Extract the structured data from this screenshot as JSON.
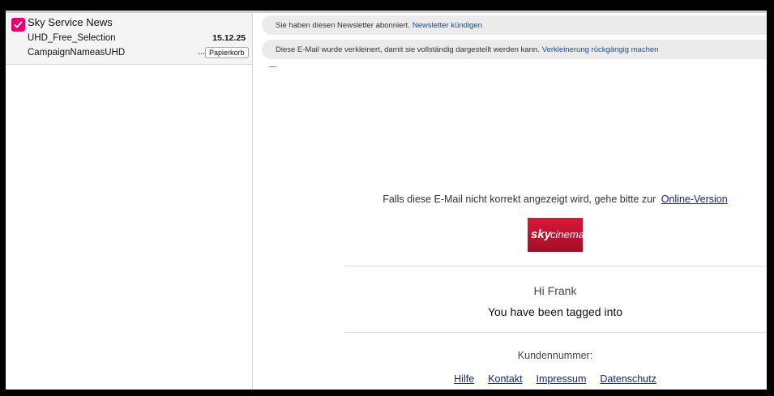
{
  "colors": {
    "accent": "#e20074",
    "link": "#1a4b9c",
    "sky_red": "#c8102e"
  },
  "mail_list": {
    "items": [
      {
        "checked": true,
        "sender": "Sky Service News",
        "subject": "UHD_Free_Selection",
        "date": "15.12.25",
        "preview": "CampaignNameasUHD",
        "ellipsis": "...",
        "folder_badge": "Papierkorb"
      }
    ]
  },
  "reading_pane": {
    "newsletter_bar": {
      "text": "Sie haben diesen Newsletter abonniert.",
      "link": "Newsletter kündigen"
    },
    "shrink_bar": {
      "text": "Diese E-Mail wurde verkleinert, damit sie vollständig dargestellt werden kann.",
      "link": "Verkleinerung rückgängig machen"
    },
    "email": {
      "online_text": "Falls diese E-Mail nicht korrekt angezeigt wird, gehe bitte zur",
      "online_link": "Online-Version",
      "logo_text": "sky cinema",
      "greeting": "Hi Frank",
      "tagline": "You have been tagged into",
      "customer_number_label": "Kundennummer:",
      "footer_links": [
        "Hilfe",
        "Kontakt",
        "Impressum",
        "Datenschutz"
      ]
    }
  }
}
